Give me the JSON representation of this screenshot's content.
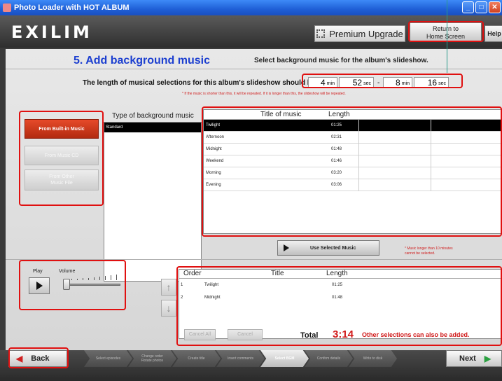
{
  "window": {
    "title": "Photo Loader with HOT ALBUM",
    "btn_min": "_",
    "btn_max": "□",
    "btn_close": "✕"
  },
  "header": {
    "logo": "EXILIM",
    "premium_label": "Premium Upgrade",
    "home_label_1": "Return to",
    "home_label_2": "Home Screen",
    "help_label": "Help"
  },
  "main": {
    "step_title": "5. Add background music",
    "step_desc": "Select background music for the album's slideshow.",
    "length_label": "The length of musical selections for this album's slideshow should be",
    "length_min_from": "4",
    "length_sec_from": "52",
    "length_min_to": "8",
    "length_sec_to": "16",
    "unit_min": "min",
    "unit_sec": "sec",
    "dash": "-",
    "warn_repeat": "* If the music is shorter than this, it will be repeated. If it is longer than this, the slideshow will be repeated."
  },
  "sources": {
    "builtin": "From Built-in Music",
    "cd": "From Music CD",
    "file_1": "From Other",
    "file_2": "Music File"
  },
  "type_list": {
    "header": "Type of background music",
    "items": [
      "Standard"
    ]
  },
  "music_table": {
    "header_title": "Title of music",
    "header_length": "Length",
    "rows": [
      {
        "title": "Twilight",
        "length": "01:25"
      },
      {
        "title": "Afternoon",
        "length": "02:31"
      },
      {
        "title": "Midnight",
        "length": "01:48"
      },
      {
        "title": "Weekend",
        "length": "01:46"
      },
      {
        "title": "Morning",
        "length": "03:20"
      },
      {
        "title": "Evening",
        "length": "03:06"
      }
    ]
  },
  "use_button": "Use Selected Music",
  "warn_long_1": "* Music longer than 10 minutes",
  "warn_long_2": "cannot be selected.",
  "player": {
    "play_label": "Play",
    "volume_label": "Volume"
  },
  "order_table": {
    "header_order": "Order",
    "header_title": "Title",
    "header_length": "Length",
    "rows": [
      {
        "order": "1",
        "title": "Twilight",
        "length": "01:25"
      },
      {
        "order": "2",
        "title": "Midnight",
        "length": "01:48"
      }
    ]
  },
  "order_actions": {
    "cancel_all": "Cancel All",
    "cancel": "Cancel"
  },
  "total": {
    "label": "Total",
    "value": "3:14",
    "note": "Other selections can also be added."
  },
  "nav": {
    "back": "Back",
    "next": "Next",
    "steps": [
      {
        "l1": "Select episodes",
        "l2": ""
      },
      {
        "l1": "Change order",
        "l2": "Rotate photos"
      },
      {
        "l1": "Create title",
        "l2": ""
      },
      {
        "l1": "Insert comments",
        "l2": ""
      },
      {
        "l1": "Select BGM",
        "l2": ""
      },
      {
        "l1": "Confirm details",
        "l2": ""
      },
      {
        "l1": "Write to disk",
        "l2": ""
      }
    ]
  },
  "colors": {
    "accent_red": "#e01010",
    "title_blue": "#1c3fd0",
    "selected_row": "#000000"
  }
}
